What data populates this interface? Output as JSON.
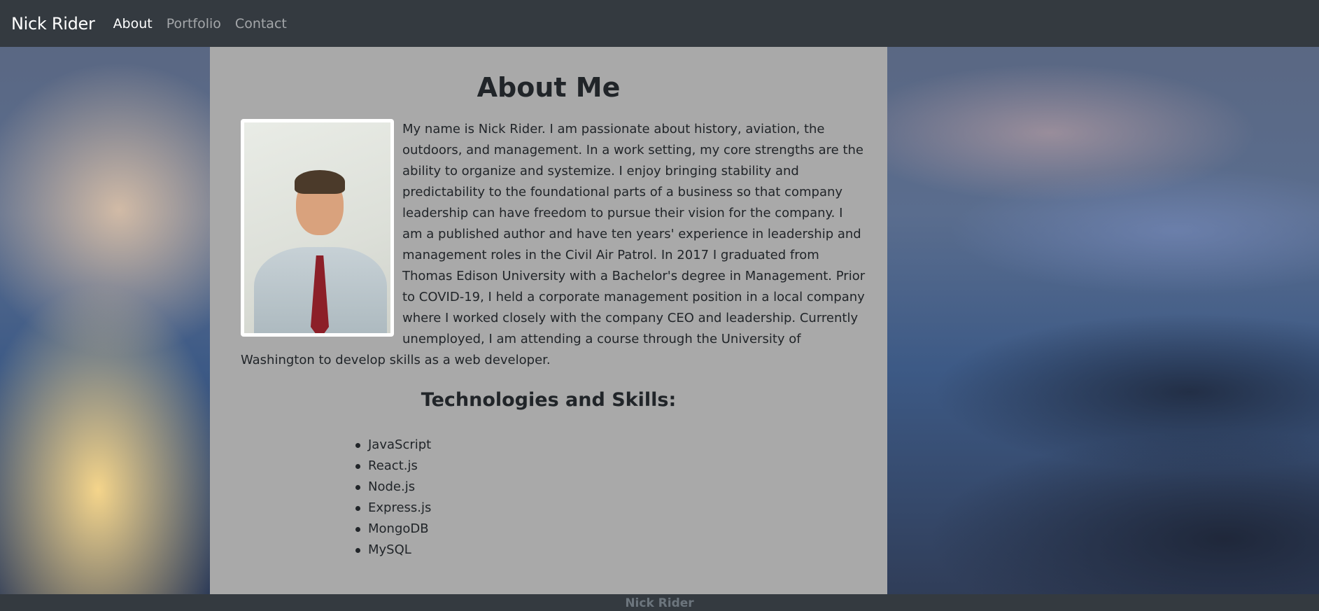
{
  "navbar": {
    "brand": "Nick Rider",
    "links": [
      {
        "label": "About",
        "active": true
      },
      {
        "label": "Portfolio",
        "active": false
      },
      {
        "label": "Contact",
        "active": false
      }
    ]
  },
  "main": {
    "title": "About Me",
    "photo_alt": "photo of Nick Rider",
    "bio": "My name is Nick Rider. I am passionate about history, aviation, the outdoors, and management. In a work setting, my core strengths are the ability to organize and systemize. I enjoy bringing stability and predictability to the foundational parts of a business so that company leadership can have freedom to pursue their vision for the company. I am a published author and have ten years' experience in leadership and management roles in the Civil Air Patrol. In 2017 I graduated from Thomas Edison University with a Bachelor's degree in Management. Prior to COVID-19, I held a corporate management position in a local company where I worked closely with the company CEO and leadership. Currently unemployed, I am attending a course through the University of Washington to develop skills as a web developer.",
    "skills_title": "Technologies and Skills:",
    "skills": [
      "JavaScript",
      "React.js",
      "Node.js",
      "Express.js",
      "MongoDB",
      "MySQL"
    ]
  },
  "footer": {
    "text": "Nick Rider"
  }
}
